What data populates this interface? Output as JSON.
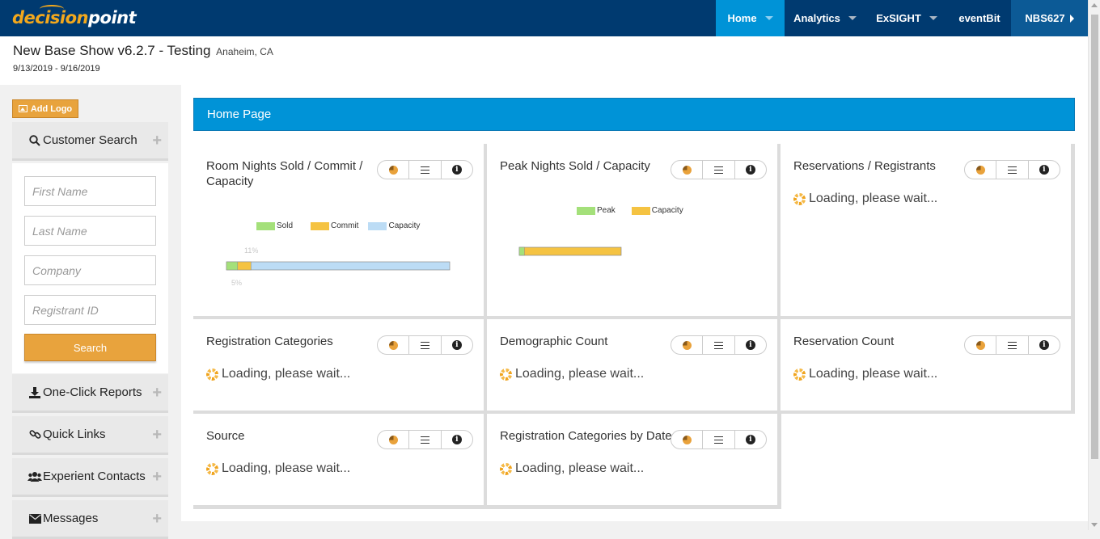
{
  "brand": {
    "logo_part1": "decision",
    "logo_part2": "point"
  },
  "nav": {
    "home": "Home",
    "analytics": "Analytics",
    "exsight": "ExSIGHT",
    "eventbit": "eventBit",
    "user": "NBS627"
  },
  "show": {
    "title": "New Base Show v6.2.7 - Testing",
    "location": "Anaheim, CA",
    "dates": "9/13/2019 - 9/16/2019"
  },
  "sidebar": {
    "add_logo": "Add Logo",
    "customer_search": "Customer Search",
    "placeholders": {
      "first_name": "First Name",
      "last_name": "Last Name",
      "company": "Company",
      "registrant_id": "Registrant ID"
    },
    "search_button": "Search",
    "sections": {
      "one_click": "One-Click Reports",
      "quick_links": "Quick Links",
      "contacts": "Experient Contacts",
      "messages": "Messages"
    }
  },
  "page": {
    "title": "Home Page"
  },
  "loading_text": "Loading, please wait...",
  "cards": {
    "room_nights": "Room Nights Sold / Commit / Capacity",
    "peak_nights": "Peak Nights Sold / Capacity",
    "reservations": "Reservations / Registrants",
    "reg_categories": "Registration Categories",
    "demographic": "Demographic Count",
    "reservation_count": "Reservation Count",
    "source": "Source",
    "reg_by_date": "Registration Categories by Date"
  },
  "colors": {
    "sold": "#a4e07a",
    "commit": "#f5c342",
    "capacity": "#bcdcf5",
    "peak": "#a4e07a"
  },
  "chart_data": [
    {
      "type": "bar",
      "orientation": "horizontal",
      "stacked": true,
      "legend": [
        "Sold",
        "Commit",
        "Capacity"
      ],
      "data_labels": [
        "11%",
        "5%"
      ],
      "series": [
        {
          "name": "Sold",
          "values": [
            5
          ]
        },
        {
          "name": "Commit",
          "values": [
            6
          ]
        },
        {
          "name": "Capacity",
          "values": [
            100
          ]
        }
      ]
    },
    {
      "type": "bar",
      "orientation": "horizontal",
      "stacked": true,
      "legend": [
        "Peak",
        "Capacity"
      ],
      "series": [
        {
          "name": "Peak",
          "values": [
            5
          ]
        },
        {
          "name": "Capacity",
          "values": [
            100
          ]
        }
      ]
    }
  ]
}
